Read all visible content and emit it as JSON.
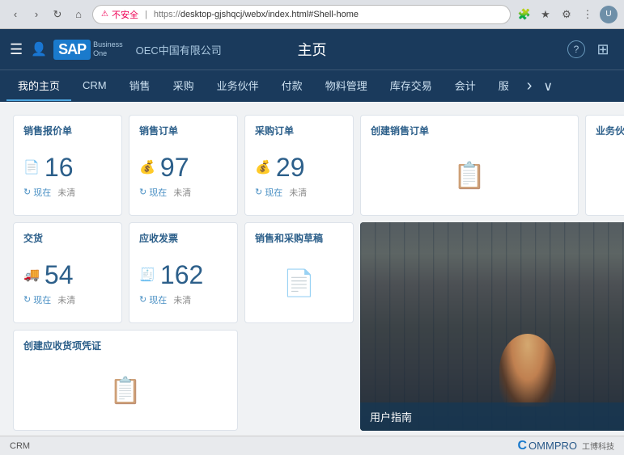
{
  "browser": {
    "back": "←",
    "forward": "→",
    "refresh": "↻",
    "home": "⌂",
    "warning_icon": "⚠",
    "warning_text": "不安全",
    "url": "https://desktop-gjshqcj/webx/index.html#Shell-home",
    "url_prefix": "https://",
    "extensions": [
      "🧩",
      "★",
      "⚙",
      "📋"
    ],
    "avatar_text": "U"
  },
  "header": {
    "menu_icon": "☰",
    "user_icon": "👤",
    "logo_text": "SAP",
    "business_line1": "Business",
    "business_line2": "One",
    "company": "OEC中国有限公司",
    "page_title": "主页",
    "help_icon": "?",
    "expand_icon": "⊞"
  },
  "nav": {
    "tabs": [
      {
        "label": "我的主页",
        "active": true
      },
      {
        "label": "CRM",
        "active": false
      },
      {
        "label": "销售",
        "active": false
      },
      {
        "label": "采购",
        "active": false
      },
      {
        "label": "业务伙伴",
        "active": false
      },
      {
        "label": "付款",
        "active": false
      },
      {
        "label": "物料管理",
        "active": false
      },
      {
        "label": "库存交易",
        "active": false
      },
      {
        "label": "会计",
        "active": false
      },
      {
        "label": "服",
        "active": false
      }
    ],
    "more_icon": "›",
    "expand_icon": "∨"
  },
  "widgets": [
    {
      "id": "sales-quote",
      "title": "销售报价单",
      "count": "16",
      "current_label": "现在",
      "pending_label": "未清",
      "icon": "📄"
    },
    {
      "id": "sales-order",
      "title": "销售订单",
      "count": "97",
      "current_label": "现在",
      "pending_label": "未清",
      "icon": "💰"
    },
    {
      "id": "purchase-order",
      "title": "采购订单",
      "count": "29",
      "current_label": "现在",
      "pending_label": "未清",
      "icon": "💰"
    },
    {
      "id": "create-sales-order",
      "title": "创建销售订单",
      "count": null,
      "icon": "📋"
    },
    {
      "id": "business-partner",
      "title": "业务伙伴",
      "count": null,
      "icon": "👤"
    },
    {
      "id": "delivery",
      "title": "交货",
      "count": "54",
      "current_label": "现在",
      "pending_label": "未清",
      "icon": "🚚"
    },
    {
      "id": "ar-invoice",
      "title": "应收发票",
      "count": "162",
      "current_label": "现在",
      "pending_label": "未清",
      "icon": "🧾"
    },
    {
      "id": "sales-purchase-draft",
      "title": "销售和采购草稿",
      "count": null,
      "icon": "📝"
    },
    {
      "id": "user-guide",
      "title": "用户指南",
      "is_image": true
    },
    {
      "id": "create-ar-receipt",
      "title": "创建应收货项凭证",
      "count": null,
      "icon": "📋"
    }
  ],
  "bottom": {
    "section_label": "CRM",
    "logo_c": "C",
    "logo_rest": "OMMPRO",
    "logo_sub": "工博科技"
  }
}
